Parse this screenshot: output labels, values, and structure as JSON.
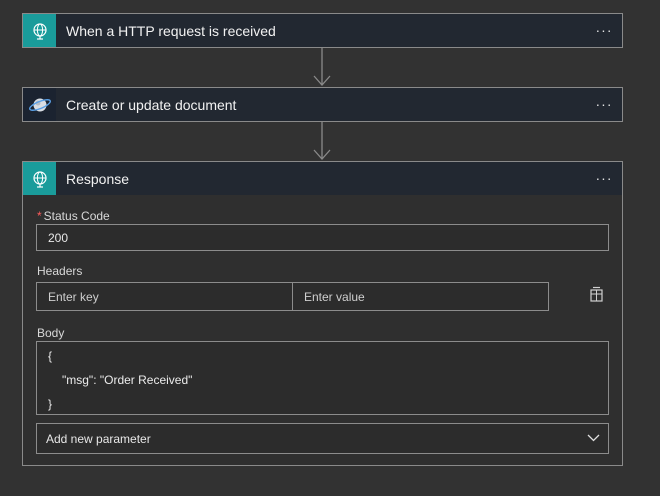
{
  "steps": [
    {
      "title": "When a HTTP request is received",
      "icon": "globe-request-icon"
    },
    {
      "title": "Create or update document",
      "icon": "cosmos-planet-icon"
    },
    {
      "title": "Response",
      "icon": "globe-response-icon"
    }
  ],
  "more_label": "···",
  "response": {
    "status_code_required": "*",
    "status_code_label": "Status Code",
    "status_code_value": "200",
    "headers_label": "Headers",
    "header_key_placeholder": "Enter key",
    "header_value_placeholder": "Enter value",
    "body_label": "Body",
    "body_lines": [
      "{",
      "\"msg\": \"Order Received\"",
      "}"
    ],
    "add_param_label": "Add new parameter"
  },
  "colors": {
    "canvas": "#323232",
    "header_bg": "#222831",
    "accent_teal": "#1a9c9b",
    "required": "#ff5b5b"
  }
}
